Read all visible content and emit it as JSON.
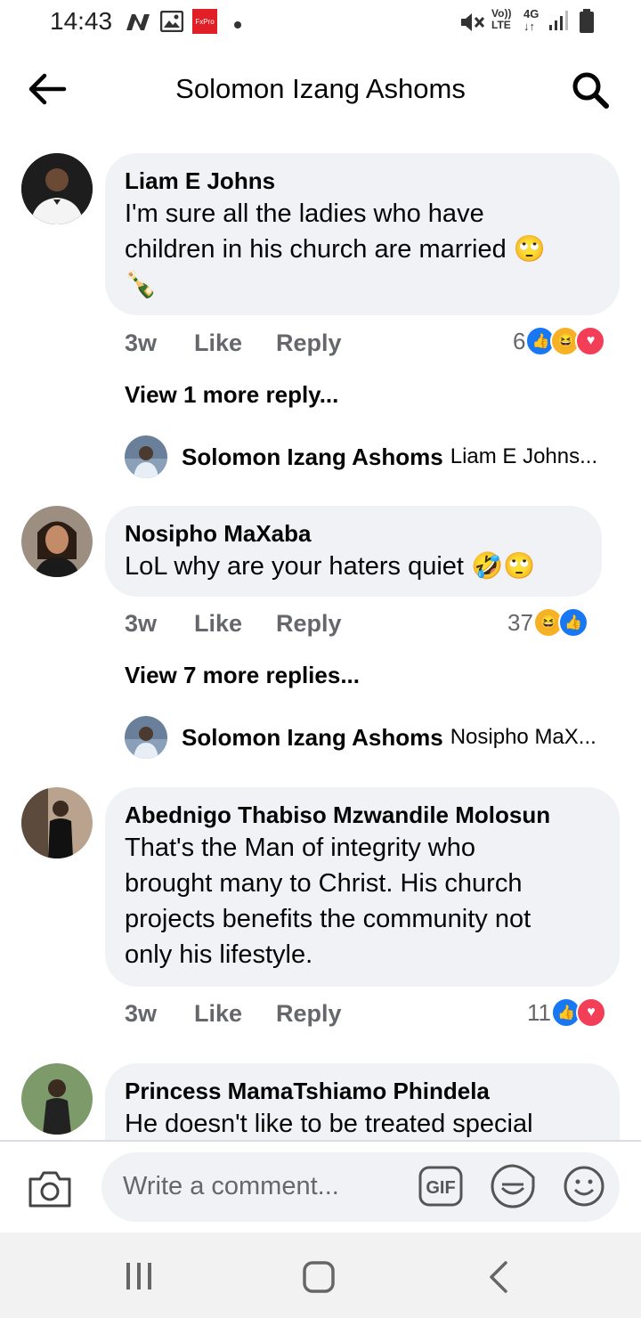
{
  "status_bar": {
    "time": "14:43",
    "network": "4G",
    "carrier_label": "Vo)) LTE",
    "icons": [
      "n-icon",
      "gallery-icon",
      "fxpro-icon",
      "dot-icon",
      "mute-icon",
      "signal-icon",
      "battery-icon"
    ]
  },
  "header": {
    "title": "Solomon Izang Ashoms"
  },
  "comments": [
    {
      "name": "Liam E Johns",
      "lines": [
        "I'm sure all the ladies who have",
        "children in his church are married 🙄",
        "🍾"
      ],
      "time": "3w",
      "like": "Like",
      "reply": "Reply",
      "reaction_count": "6",
      "reactions": [
        "like",
        "haha",
        "love"
      ],
      "view_more": "View 1 more reply...",
      "reply_preview": {
        "name": "Solomon Izang Ashoms",
        "text": "Liam E Johns..."
      }
    },
    {
      "name": "Nosipho MaXaba",
      "lines": [
        "LoL why are your haters quiet 🤣🙄"
      ],
      "time": "3w",
      "like": "Like",
      "reply": "Reply",
      "reaction_count": "37",
      "reactions": [
        "haha",
        "like"
      ],
      "view_more": "View 7 more replies...",
      "reply_preview": {
        "name": "Solomon Izang Ashoms",
        "text": "Nosipho MaX..."
      }
    },
    {
      "name": "Abednigo Thabiso Mzwandile Molosun",
      "lines": [
        "That's the Man of integrity who",
        "brought many to Christ. His church",
        "projects benefits the community not",
        "only his lifestyle."
      ],
      "time": "3w",
      "like": "Like",
      "reply": "Reply",
      "reaction_count": "11",
      "reactions": [
        "like",
        "love"
      ]
    },
    {
      "name": "Princess MamaTshiamo Phindela",
      "lines": [
        "He doesn't like to be treated special"
      ]
    }
  ],
  "composer": {
    "placeholder": "Write a comment...",
    "gif_label": "GIF"
  },
  "colors": {
    "bubble": "#f0f2f5",
    "like_blue": "#1877f2",
    "love_red": "#f33e58",
    "haha_yellow": "#f7b125",
    "meta_gray": "#65676b"
  }
}
